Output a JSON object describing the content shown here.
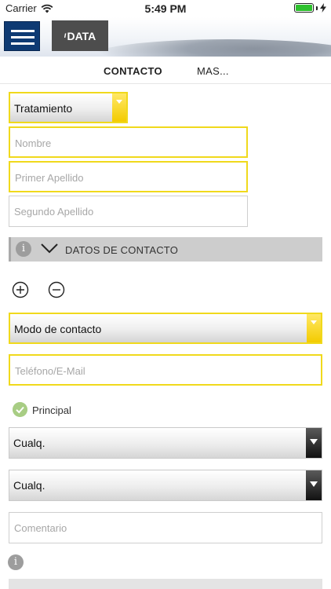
{
  "status_bar": {
    "carrier": "Carrier",
    "time": "5:49 PM",
    "battery_level": 1.0,
    "wifi_icon": "wifi-icon",
    "battery_icon": "battery-icon",
    "charging_icon": "bolt-icon"
  },
  "header": {
    "menu_icon": "hamburger-icon",
    "logo_text": "DATA",
    "logo_mark": "ı",
    "brand_color": "#0e3a73"
  },
  "tabs": [
    {
      "label": "CONTACTO",
      "active": true
    },
    {
      "label": "MAS...",
      "active": false
    }
  ],
  "form": {
    "tratamiento": {
      "label": "Tratamiento"
    },
    "nombre": {
      "placeholder": "Nombre"
    },
    "primer_apellido": {
      "placeholder": "Primer Apellido"
    },
    "segundo_apellido": {
      "placeholder": "Segundo Apellido"
    }
  },
  "contact_section": {
    "title": "DATOS DE CONTACTO",
    "info_icon": "info-icon",
    "toggle_icon": "chevron-down-icon",
    "add_icon": "plus-circle-icon",
    "remove_icon": "minus-circle-icon",
    "modo_contacto": {
      "label": "Modo de contacto"
    },
    "telefono_email": {
      "placeholder": "Teléfono/E-Mail"
    },
    "principal": {
      "label": "Principal",
      "checked": true
    },
    "select_1": {
      "label": "Cualq."
    },
    "select_2": {
      "label": "Cualq."
    },
    "comentario": {
      "placeholder": "Comentario"
    }
  },
  "colors": {
    "required_border": "#f0d91c",
    "check_green": "#a8cd84",
    "section_bg": "#cdcdcd"
  }
}
